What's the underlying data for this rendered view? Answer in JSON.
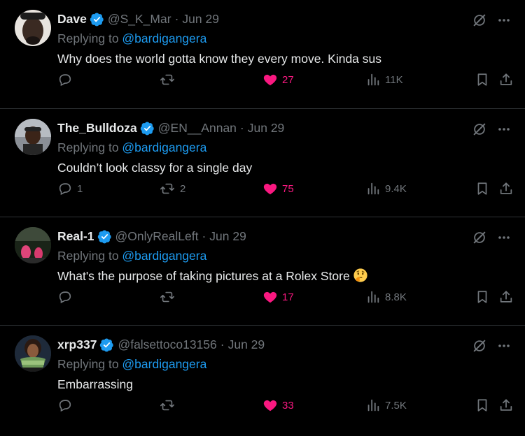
{
  "tweets": [
    {
      "name": "Dave",
      "handle": "@S_K_Mar",
      "date": "Jun 29",
      "replying_prefix": "Replying to ",
      "replying_to": "@bardigangera",
      "text": "Why does the world gotta know they every move. Kinda sus",
      "replies": "",
      "retweets": "",
      "likes": "27",
      "views": "11K"
    },
    {
      "name": "The_Bulldoza",
      "handle": "@EN__Annan",
      "date": "Jun 29",
      "replying_prefix": "Replying to ",
      "replying_to": "@bardigangera",
      "text": "Couldn’t look classy for a single day",
      "replies": "1",
      "retweets": "2",
      "likes": "75",
      "views": "9.4K"
    },
    {
      "name": "Real-1",
      "handle": "@OnlyRealLeft",
      "date": "Jun 29",
      "replying_prefix": "Replying to ",
      "replying_to": "@bardigangera",
      "text": "What's the purpose of taking pictures at a Rolex Store",
      "emoji": "thinking-face",
      "replies": "",
      "retweets": "",
      "likes": "17",
      "views": "8.8K"
    },
    {
      "name": "xrp337",
      "handle": "@falsettoco13156",
      "date": "Jun 29",
      "replying_prefix": "Replying to ",
      "replying_to": "@bardigangera",
      "text": "Embarrassing",
      "replies": "",
      "retweets": "",
      "likes": "33",
      "views": "7.5K"
    }
  ],
  "separator": "·",
  "colors": {
    "background": "#000000",
    "text": "#e7e9ea",
    "muted": "#71767b",
    "link": "#1d9bf0",
    "like": "#f91880",
    "border": "#2f3336"
  }
}
